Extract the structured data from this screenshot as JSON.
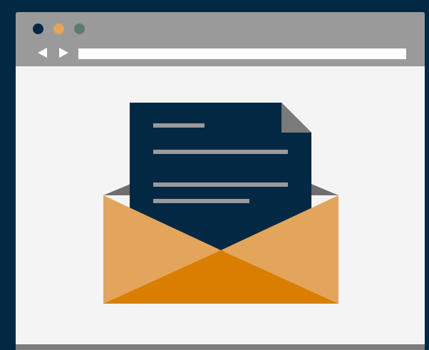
{
  "window": {
    "controls": [
      {
        "name": "close",
        "color": "#022843"
      },
      {
        "name": "minimize",
        "color": "#e3a55b"
      },
      {
        "name": "maximize",
        "color": "#5b7a74"
      }
    ],
    "nav": {
      "back_icon": "triangle-left-icon",
      "forward_icon": "triangle-right-icon"
    },
    "address_bar": {
      "value": ""
    }
  },
  "illustration": {
    "icon": "open-envelope-with-letter-icon",
    "colors": {
      "background": "#022843",
      "page": "#f4f4f4",
      "letter": "#022843",
      "letter_fold": "#7a7a7a",
      "letter_lines": "#9a9a9a",
      "envelope_back": "#6f6f6f",
      "envelope_sides": "#e3a55b",
      "envelope_bottom": "#d97e00"
    }
  }
}
